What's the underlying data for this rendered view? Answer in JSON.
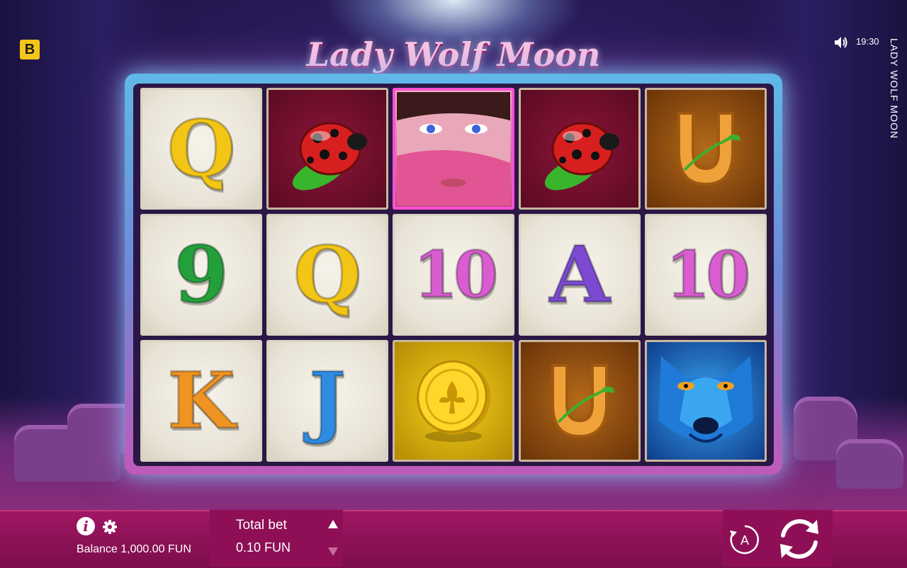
{
  "brand": {
    "badge": "B"
  },
  "game": {
    "title": "Lady Wolf Moon",
    "side_title": "LADY WOLF MOON"
  },
  "status": {
    "time": "19:30"
  },
  "reels": [
    [
      {
        "symbol": "Q",
        "type": "letter",
        "color": "#f2c516"
      },
      {
        "symbol": "ladybug",
        "type": "picture",
        "bg": "red"
      },
      {
        "symbol": "lady",
        "type": "picture",
        "bg": "pink"
      },
      {
        "symbol": "ladybug",
        "type": "picture",
        "bg": "red"
      },
      {
        "symbol": "horseshoe",
        "type": "picture",
        "bg": "amber"
      }
    ],
    [
      {
        "symbol": "9",
        "type": "letter",
        "color": "#23a03b"
      },
      {
        "symbol": "Q",
        "type": "letter",
        "color": "#f2c516"
      },
      {
        "symbol": "10",
        "type": "letter",
        "color": "#d95dd0"
      },
      {
        "symbol": "A",
        "type": "letter",
        "color": "#7b4ad1"
      },
      {
        "symbol": "10",
        "type": "letter",
        "color": "#d95dd0"
      }
    ],
    [
      {
        "symbol": "K",
        "type": "letter",
        "color": "#ef9323"
      },
      {
        "symbol": "J",
        "type": "letter",
        "color": "#2f8be0"
      },
      {
        "symbol": "coin",
        "type": "picture",
        "bg": "gold"
      },
      {
        "symbol": "horseshoe",
        "type": "picture",
        "bg": "amber"
      },
      {
        "symbol": "wolf",
        "type": "picture",
        "bg": "blue"
      }
    ]
  ],
  "footer": {
    "balance": "Balance 1,000.00 FUN",
    "total_bet_label": "Total bet",
    "total_bet_value": "0.10 FUN",
    "auto_label": "A"
  },
  "icons": {
    "info": "info-icon",
    "settings": "gear-icon",
    "sound": "volume-icon",
    "bet_up": "triangle-up-icon",
    "bet_down": "triangle-down-icon",
    "autoplay": "autoplay-icon",
    "spin": "spin-icon"
  },
  "colors": {
    "bar": "#a01763",
    "accent": "#ff4fd2"
  }
}
